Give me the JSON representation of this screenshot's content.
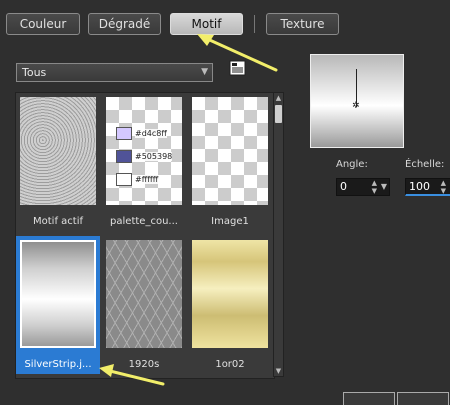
{
  "tabs": [
    {
      "label": "Couleur",
      "active": false
    },
    {
      "label": "Dégradé",
      "active": false
    },
    {
      "label": "Motif",
      "active": true
    },
    {
      "label": "Texture",
      "active": false
    }
  ],
  "filter": {
    "selected": "Tous"
  },
  "patterns": [
    {
      "caption": "Motif actif",
      "style": "noise"
    },
    {
      "caption": "palette_cou...",
      "style": "palette"
    },
    {
      "caption": "Image1",
      "style": "checker"
    },
    {
      "caption": "SilverStrip.j...",
      "style": "silver",
      "selected": true
    },
    {
      "caption": "1920s",
      "style": "pattern1920"
    },
    {
      "caption": "1or02",
      "style": "gold"
    }
  ],
  "palette_colors": [
    {
      "hex": "#d4c8ff",
      "label": "#d4c8ff"
    },
    {
      "hex": "#505398",
      "label": "#505398"
    },
    {
      "hex": "#ffffff",
      "label": "#ffffff"
    }
  ],
  "angle": {
    "label": "Angle:",
    "value": "0"
  },
  "scale": {
    "label": "Échelle:",
    "value": "100"
  },
  "accent": "#2b7bd3",
  "annotation_color": "#f2ee6a"
}
